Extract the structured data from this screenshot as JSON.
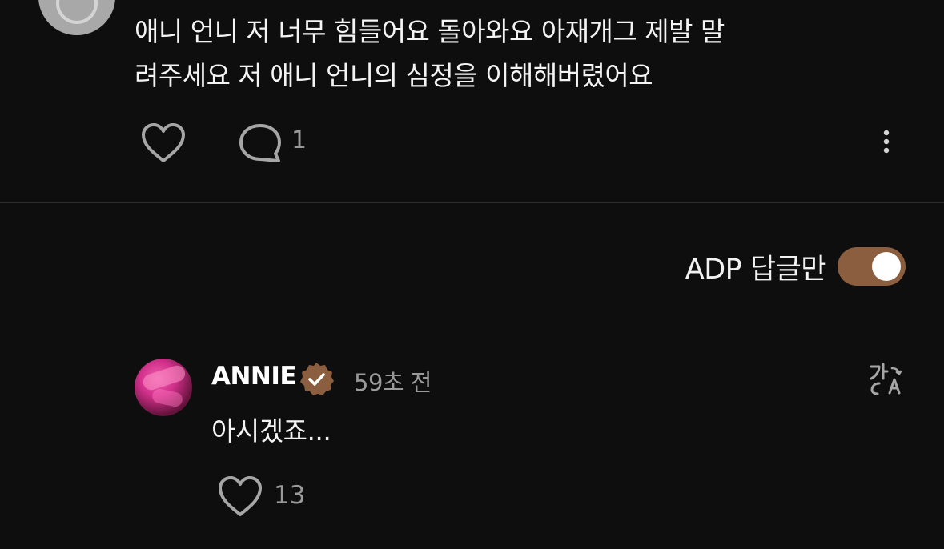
{
  "top_comment": {
    "text_line1": "애니 언니 저 너무 힘들어요 돌아와요 아재개그 제발 말",
    "text_line2": "려주세요 저 애니 언니의 심정을 이해해버렸어요",
    "reply_count": "1"
  },
  "filter": {
    "label": "ADP 답글만",
    "enabled": true,
    "accent_color": "#8a5e3f"
  },
  "reply": {
    "username": "ANNIE",
    "timestamp": "59초 전",
    "text": "아시겠죠...",
    "like_count": "13"
  },
  "icons": {
    "like": "heart-icon",
    "reply": "speech-bubble-icon",
    "more": "more-vertical-icon",
    "translate": "translate-icon",
    "verified": "verified-badge-icon"
  },
  "colors": {
    "background": "#0f0e0e",
    "muted_text": "#9a9a9a",
    "badge": "#8a5e3f"
  }
}
